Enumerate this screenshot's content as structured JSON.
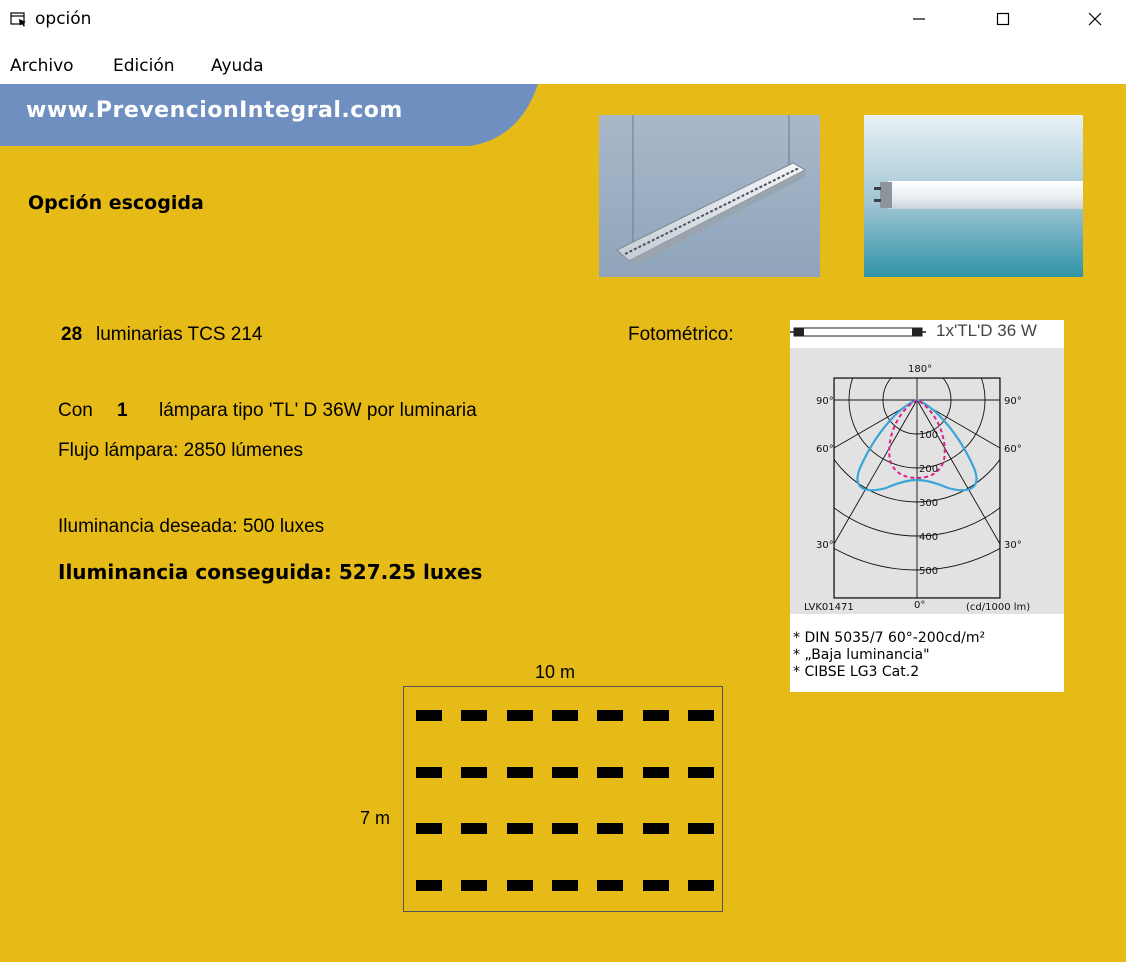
{
  "window": {
    "title": "opción",
    "minimize_glyph": "—",
    "maximize_glyph": "☐",
    "close_glyph": "✕"
  },
  "menu": {
    "items": [
      "Archivo",
      "Edición",
      "Ayuda"
    ]
  },
  "banner": {
    "text": "www.PrevencionIntegral.com"
  },
  "heading": "Opción escogida",
  "result": {
    "luminaire_count": "28",
    "luminaire_model": "luminarias TCS 214",
    "con_label": "Con",
    "lamps_per_luminaire": "1",
    "lamp_text": "lámpara tipo 'TL' D 36W por luminaria",
    "lamp_flux": "Flujo lámpara: 2850 lúmenes",
    "desired_illuminance": "Iluminancia deseada: 500 luxes",
    "achieved_illuminance": "Iluminancia conseguida: 527.25 luxes"
  },
  "photometric": {
    "label": "Fotométrico:",
    "lamp_caption": "1x'TL'D 36 W",
    "angle_labels": [
      "180°",
      "90°",
      "90°",
      "60°",
      "60°",
      "30°",
      "30°",
      "0°"
    ],
    "scale_labels": [
      "100",
      "200",
      "300",
      "400",
      "500"
    ],
    "code": "LVK01471",
    "unit": "(cd/1000 lm)",
    "notes": [
      "* DIN 5035/7 60°-200cd/m²",
      "* „Baja luminancia\"",
      "* CIBSE LG3 Cat.2"
    ]
  },
  "layout_plan": {
    "width_label": "10 m",
    "height_label": "7 m",
    "rows": 4,
    "columns": 7
  },
  "colors": {
    "background": "#e6bb17",
    "banner": "#6f8fc0",
    "curve_solid": "#3aa6d8",
    "curve_dashed": "#e0208a"
  },
  "icons": {
    "app": "window-icon",
    "minimize": "minimize-icon",
    "maximize": "maximize-icon",
    "close": "close-icon"
  }
}
